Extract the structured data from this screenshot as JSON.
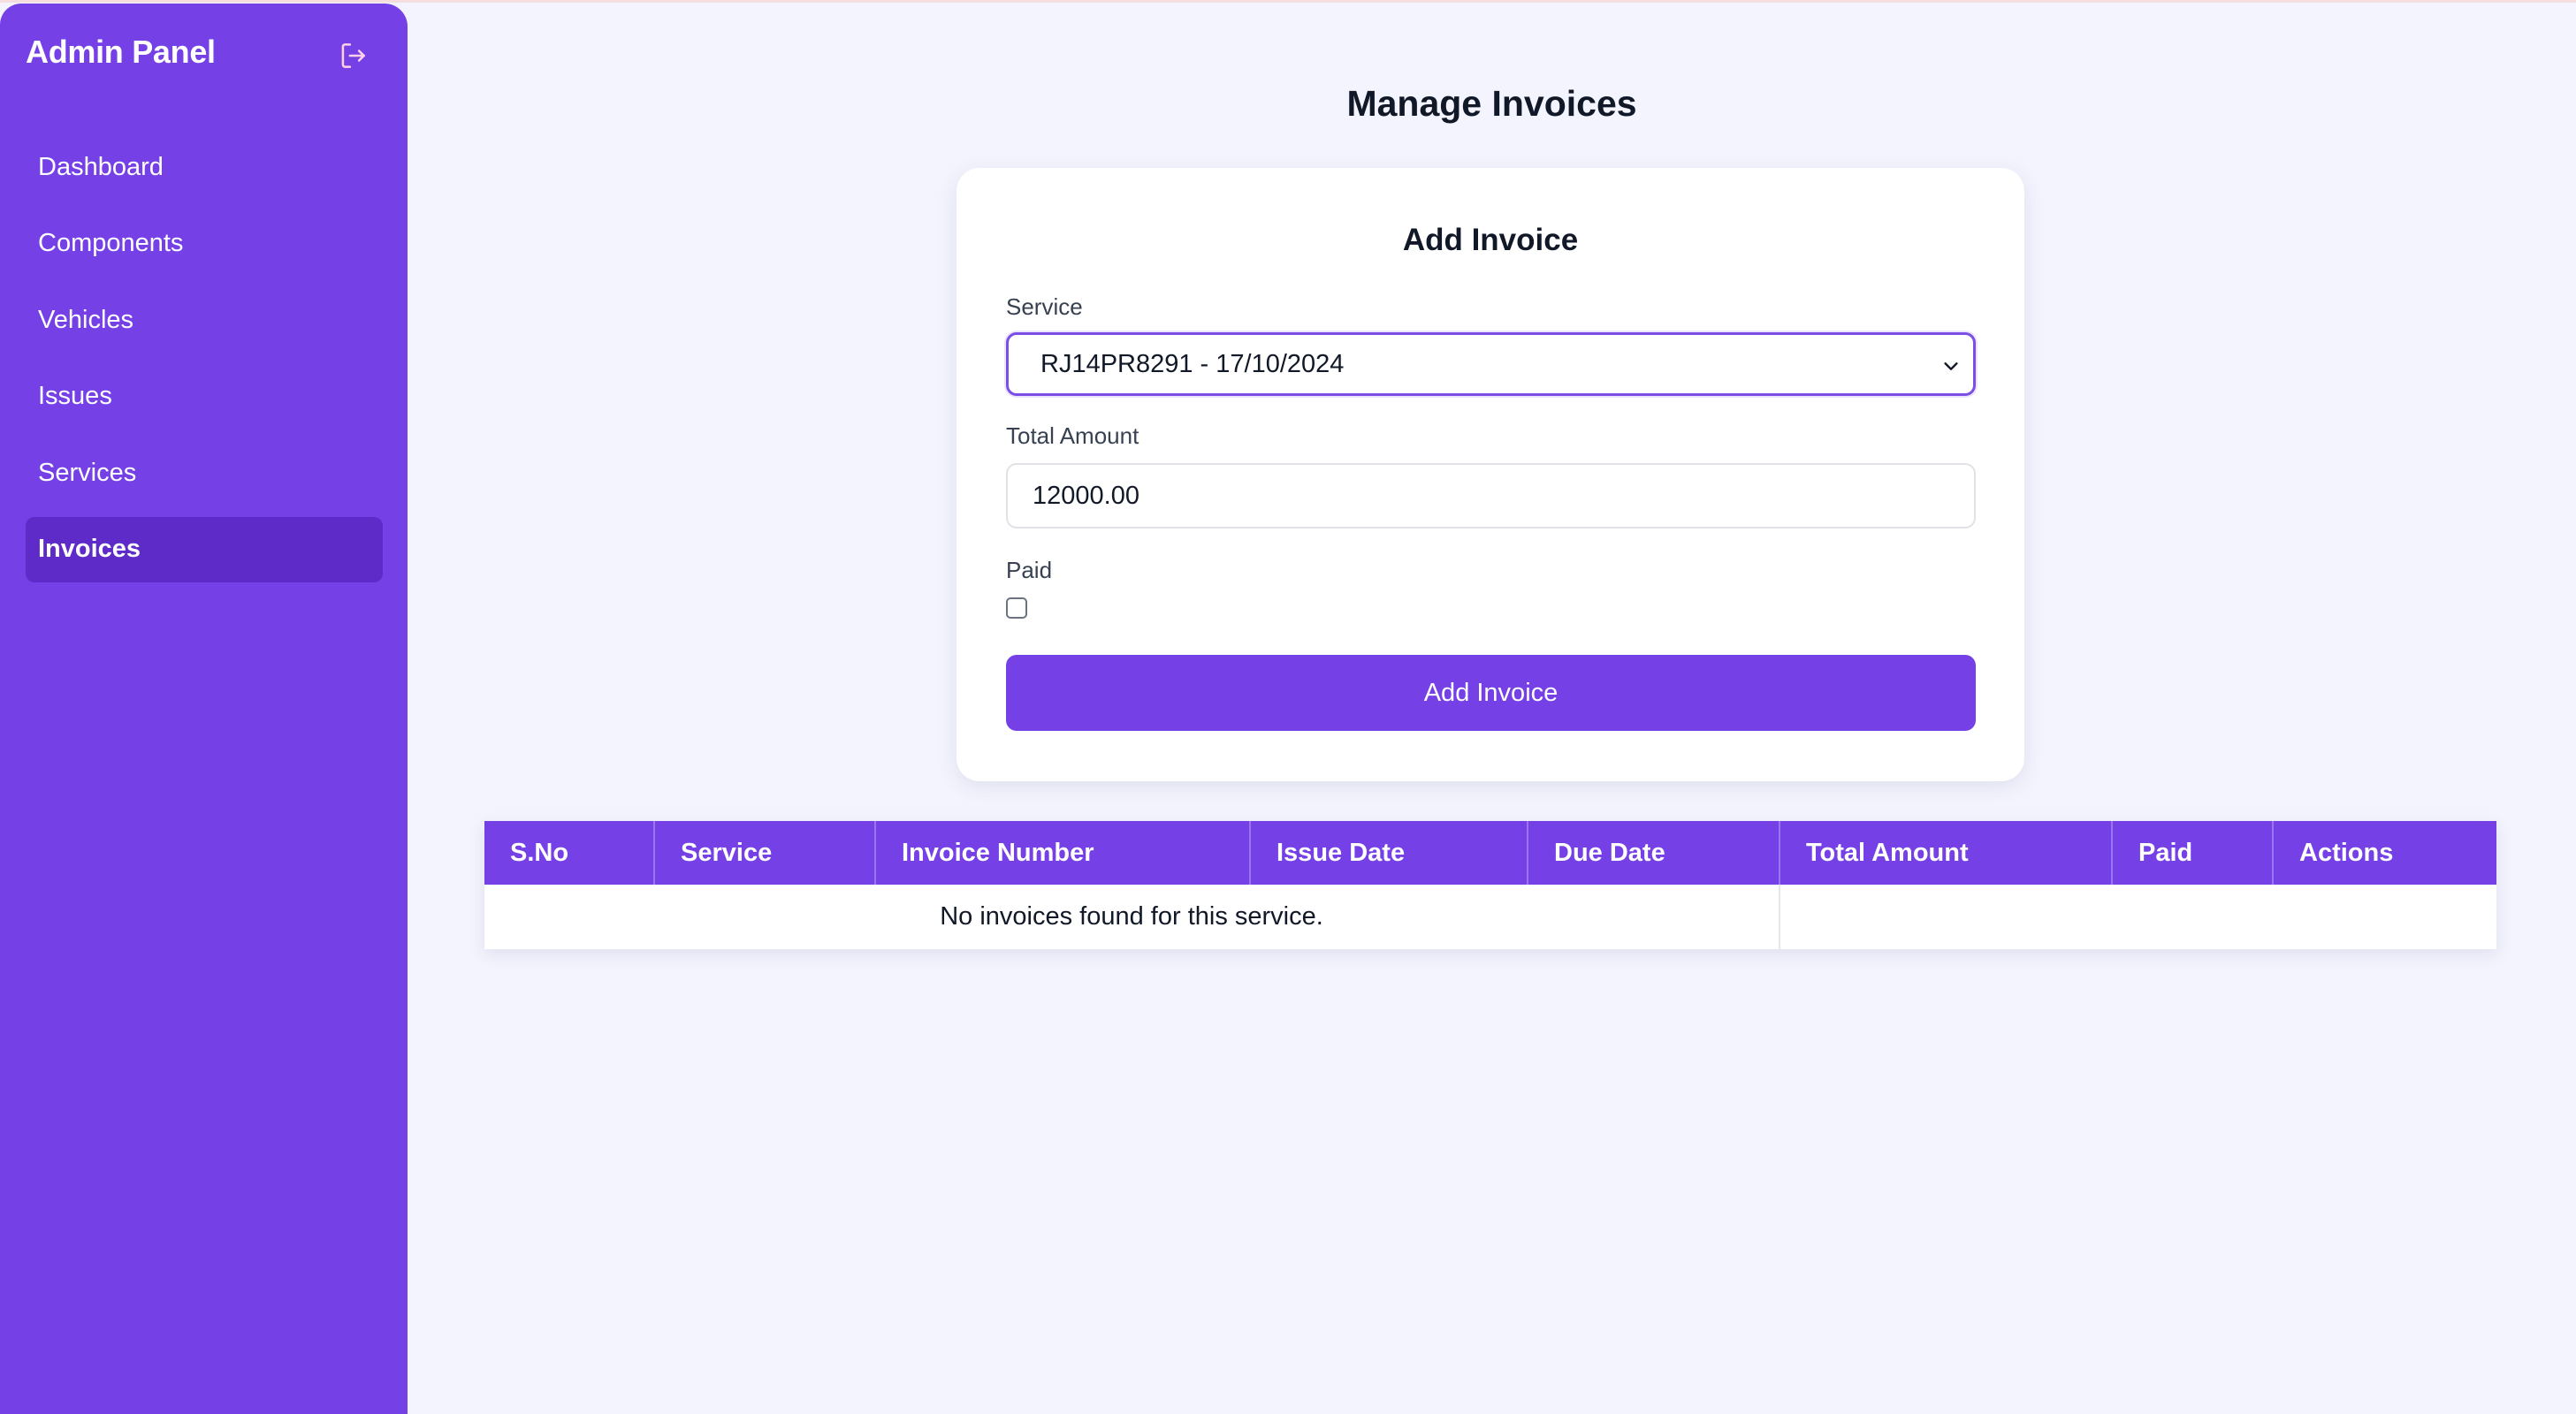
{
  "sidebar": {
    "brand": "Admin Panel",
    "logout_icon": "logout-icon",
    "items": [
      {
        "label": "Dashboard",
        "active": false
      },
      {
        "label": "Components",
        "active": false
      },
      {
        "label": "Vehicles",
        "active": false
      },
      {
        "label": "Issues",
        "active": false
      },
      {
        "label": "Services",
        "active": false
      },
      {
        "label": "Invoices",
        "active": true
      }
    ]
  },
  "main": {
    "page_title": "Manage Invoices",
    "form": {
      "title": "Add Invoice",
      "service_label": "Service",
      "service_value": "RJ14PR8291 - 17/10/2024",
      "total_label": "Total Amount",
      "total_value": "12000.00",
      "paid_label": "Paid",
      "paid_checked": false,
      "submit_label": "Add Invoice"
    },
    "table": {
      "columns": [
        "S.No",
        "Service",
        "Invoice Number",
        "Issue Date",
        "Due Date",
        "Total Amount",
        "Paid",
        "Actions"
      ],
      "empty_message": "No invoices found for this service."
    }
  },
  "colors": {
    "accent": "#7540e6",
    "accent_active": "#5e2bc9",
    "background": "#f3f4fd"
  }
}
